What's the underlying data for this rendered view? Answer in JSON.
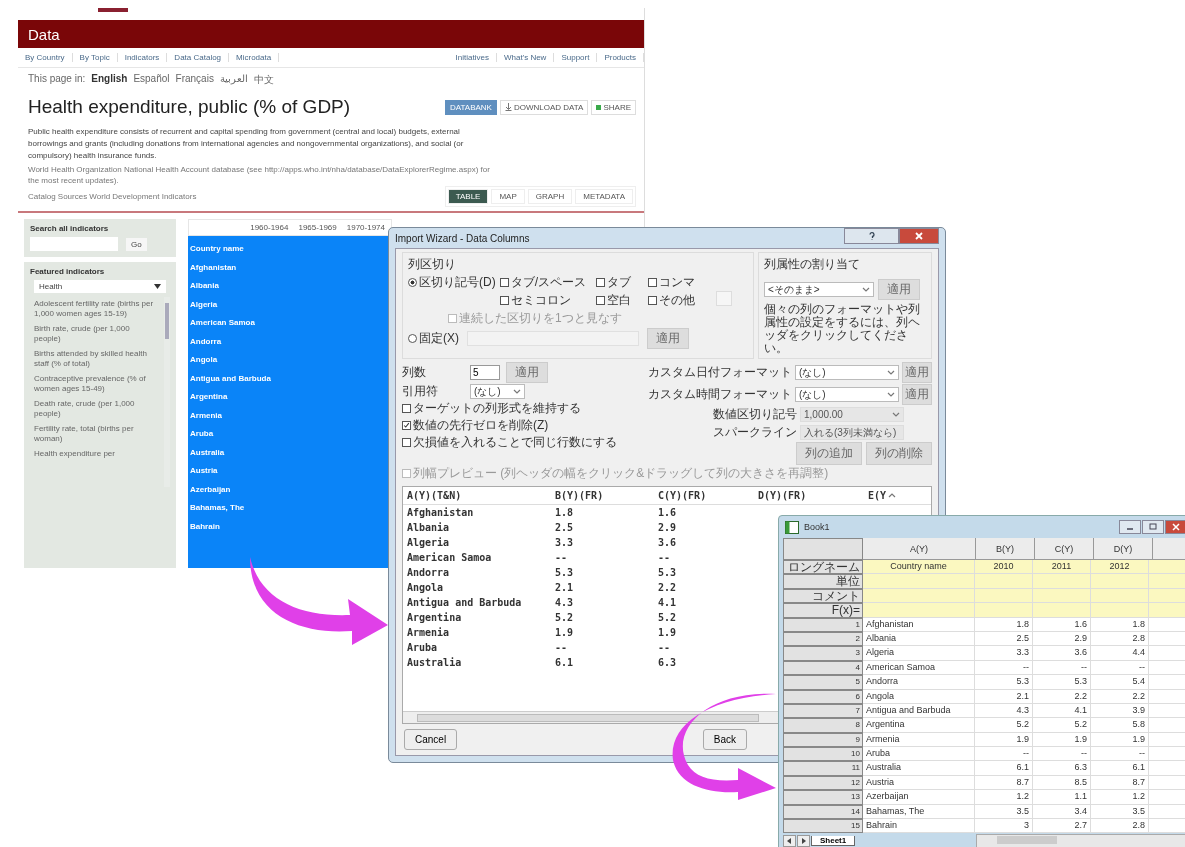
{
  "web_page": {
    "header": "Data",
    "nav_left": [
      "By Country",
      "By Topic",
      "Indicators",
      "Data Catalog",
      "Microdata"
    ],
    "nav_right": [
      "Initiatives",
      "What's New",
      "Support",
      "Products"
    ],
    "language_label": "This page in:",
    "languages": [
      {
        "label": "English",
        "selected": true
      },
      {
        "label": "Español",
        "selected": false
      },
      {
        "label": "Français",
        "selected": false
      },
      {
        "label": "العربية",
        "selected": false
      },
      {
        "label": "中文",
        "selected": false
      }
    ],
    "title": "Health expenditure, public (% of GDP)",
    "actions": [
      {
        "label": "DATABANK",
        "kind": "primary"
      },
      {
        "label": "DOWNLOAD DATA",
        "kind": "download"
      },
      {
        "label": "SHARE",
        "kind": "share"
      }
    ],
    "description": "Public health expenditure consists of recurrent and capital spending from government (central and local) budgets, external borrowings and grants (including donations from international agencies and nongovernmental organizations), and social (or compulsory) health insurance funds.",
    "source": "World Health Organization National Health Account database (see http://apps.who.int/nha/database/DataExplorerRegime.aspx) for the most recent updates).",
    "catalog": "Catalog Sources World Development Indicators",
    "view_tabs": [
      {
        "label": "TABLE",
        "selected": true
      },
      {
        "label": "MAP",
        "selected": false
      },
      {
        "label": "GRAPH",
        "selected": false
      },
      {
        "label": "METADATA",
        "selected": false
      }
    ],
    "sidebar": {
      "search_label": "Search all indicators",
      "go_button": "Go",
      "featured_label": "Featured indicators",
      "category": "Health",
      "indicators": [
        "Adolescent fertility rate (births per 1,000 women ages 15-19)",
        "Birth rate, crude (per 1,000 people)",
        "Births attended by skilled health staff (% of total)",
        "Contraceptive prevalence (% of women ages 15-49)",
        "Death rate, crude (per 1,000 people)",
        "Fertility rate, total (births per woman)",
        "Health expenditure per"
      ]
    },
    "table": {
      "columns": [
        "1960-1964",
        "1965-1969",
        "1970-1974"
      ],
      "rows": [
        "Country name",
        "Afghanistan",
        "Albania",
        "Algeria",
        "American Samoa",
        "Andorra",
        "Angola",
        "Antigua and Barbuda",
        "Argentina",
        "Armenia",
        "Aruba",
        "Australia",
        "Austria",
        "Azerbaijan",
        "Bahamas, The",
        "Bahrain"
      ]
    }
  },
  "import_wizard": {
    "title": "Import Wizard - Data Columns",
    "delimiter_group": "列区切り",
    "modes": [
      {
        "label": "区切り記号(D)",
        "selected": true
      },
      {
        "label": "固定(X)",
        "selected": false
      }
    ],
    "delimiters": [
      {
        "label": "タブ/スペース",
        "checked": false
      },
      {
        "label": "タブ",
        "checked": false
      },
      {
        "label": "コンマ",
        "checked": false
      },
      {
        "label": "セミコロン",
        "checked": false
      },
      {
        "label": "空白",
        "checked": false
      },
      {
        "label": "その他",
        "checked": false
      }
    ],
    "merge_delimiters": {
      "label": "連続した区切りを1つと見なす",
      "checked": false,
      "disabled": true
    },
    "fixed_apply": "適用",
    "attribute_group": "列属性の割り当て",
    "attribute_select": "<そのまま>",
    "attribute_apply": "適用",
    "attribute_note": "個々の列のフォーマットや列属性の設定をするには、列ヘッダをクリックしてください。",
    "column_count_label": "列数",
    "column_count": "5",
    "column_count_apply": "適用",
    "quote_label": "引用符",
    "quote_select": "(なし)",
    "formats": [
      {
        "label": "カスタム日付フォーマット",
        "value": "(なし)",
        "kind": "editable",
        "apply": "適用"
      },
      {
        "label": "カスタム時間フォーマット",
        "value": "(なし)",
        "kind": "editable",
        "apply": "適用"
      },
      {
        "label": "数値区切り記号",
        "value": "1,000.00",
        "kind": "plain"
      },
      {
        "label": "スパークライン",
        "value": "入れる(3列未満なら)",
        "kind": "plain"
      }
    ],
    "options": [
      {
        "label": "ターゲットの列形式を維持する",
        "checked": false,
        "disabled": false
      },
      {
        "label": "数値の先行ゼロを削除(Z)",
        "checked": true,
        "disabled": false
      },
      {
        "label": "欠損値を入れることで同じ行数にする",
        "checked": false,
        "disabled": false
      }
    ],
    "preview_option": {
      "label": "列幅プレビュー (列ヘッダの幅をクリック&ドラッグして列の大きさを再調整)",
      "checked": false,
      "disabled": true
    },
    "column_buttons": [
      "列の追加",
      "列の削除"
    ],
    "preview": {
      "columns": [
        "A(Y)(T&N)",
        "B(Y)(FR)",
        "C(Y)(FR)",
        "D(Y)(FR)",
        "E(Y"
      ],
      "rows": [
        [
          "Afghanistan",
          "1.8",
          "1.6"
        ],
        [
          "Albania",
          "2.5",
          "2.9"
        ],
        [
          "Algeria",
          "3.3",
          "3.6"
        ],
        [
          "American Samoa",
          "--",
          "--"
        ],
        [
          "Andorra",
          "5.3",
          "5.3"
        ],
        [
          "Angola",
          "2.1",
          "2.2"
        ],
        [
          "Antigua and Barbuda",
          "4.3",
          "4.1"
        ],
        [
          "Argentina",
          "5.2",
          "5.2"
        ],
        [
          "Armenia",
          "1.9",
          "1.9"
        ],
        [
          "Aruba",
          "--",
          "--"
        ],
        [
          "Australia",
          "6.1",
          "6.3"
        ]
      ]
    },
    "cancel": "Cancel",
    "back": "Back"
  },
  "workbook": {
    "title": "Book1",
    "columns": [
      "A(Y)",
      "B(Y)",
      "C(Y)",
      "D(Y)"
    ],
    "label_rows": [
      {
        "label": "ロングネーム",
        "cells": [
          "Country name",
          "2010",
          "2011",
          "2012"
        ]
      },
      {
        "label": "単位",
        "cells": []
      },
      {
        "label": "コメント",
        "cells": []
      },
      {
        "label": "F(x)=",
        "cells": []
      }
    ],
    "rows": [
      [
        "1",
        "Afghanistan",
        "1.8",
        "1.6",
        "1.8"
      ],
      [
        "2",
        "Albania",
        "2.5",
        "2.9",
        "2.8"
      ],
      [
        "3",
        "Algeria",
        "3.3",
        "3.6",
        "4.4"
      ],
      [
        "4",
        "American Samoa",
        "--",
        "--",
        "--"
      ],
      [
        "5",
        "Andorra",
        "5.3",
        "5.3",
        "5.4"
      ],
      [
        "6",
        "Angola",
        "2.1",
        "2.2",
        "2.2"
      ],
      [
        "7",
        "Antigua and Barbuda",
        "4.3",
        "4.1",
        "3.9"
      ],
      [
        "8",
        "Argentina",
        "5.2",
        "5.2",
        "5.8"
      ],
      [
        "9",
        "Armenia",
        "1.9",
        "1.9",
        "1.9"
      ],
      [
        "10",
        "Aruba",
        "--",
        "--",
        "--"
      ],
      [
        "11",
        "Australia",
        "6.1",
        "6.3",
        "6.1"
      ],
      [
        "12",
        "Austria",
        "8.7",
        "8.5",
        "8.7"
      ],
      [
        "13",
        "Azerbaijan",
        "1.2",
        "1.1",
        "1.2"
      ],
      [
        "14",
        "Bahamas, The",
        "3.5",
        "3.4",
        "3.5"
      ],
      [
        "15",
        "Bahrain",
        "3",
        "2.7",
        "2.8"
      ]
    ],
    "sheets": [
      {
        "label": "Sheet1",
        "selected": true
      }
    ]
  }
}
